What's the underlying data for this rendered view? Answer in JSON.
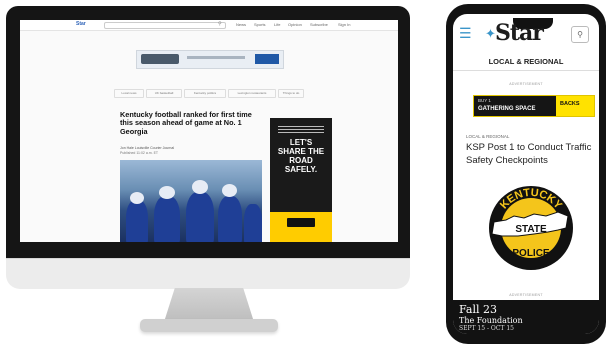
{
  "desktop": {
    "site": {
      "logo": "Star",
      "nav": [
        "News",
        "Sports",
        "Life",
        "Opinion",
        "Subscribe",
        "Sign In"
      ]
    },
    "tabs": [
      "Local news",
      "UK basketball",
      "Kentucky politics",
      "Lexington restaurants",
      "Things to do"
    ],
    "article": {
      "headline": "Kentucky football ranked for first time this season ahead of game at No. 1 Georgia",
      "byline": "Jon Hale Louisville Courier Journal",
      "date": "Published 11:02 a.m. ET"
    },
    "side_ad": {
      "text": "LET'S SHARE THE ROAD SAFELY."
    }
  },
  "phone": {
    "logo": "Star",
    "menu_icon": "hamburger-icon",
    "search_icon": "search-icon",
    "section": "LOCAL & REGIONAL",
    "ad_label": "ADVERTISEMENT",
    "ad": {
      "small": "BUY 1",
      "text": "GATHERING SPACE",
      "brand": "BACKS"
    },
    "kicker": "LOCAL & REGIONAL",
    "headline": "KSP Post 1 to Conduct Traffic Safety Checkpoints",
    "seal": {
      "top": "KENTUCKY",
      "middle": "STATE",
      "bottom": "POLICE"
    },
    "bottom_banner": {
      "line1": "Fall 23",
      "line2": "The Foundation",
      "line3": "SEPT 15 - OCT 15"
    }
  },
  "colors": {
    "accent": "#3a95c9",
    "seal_gold": "#f4c51b",
    "seal_black": "#111111",
    "ad_yellow": "#ffcc00"
  }
}
